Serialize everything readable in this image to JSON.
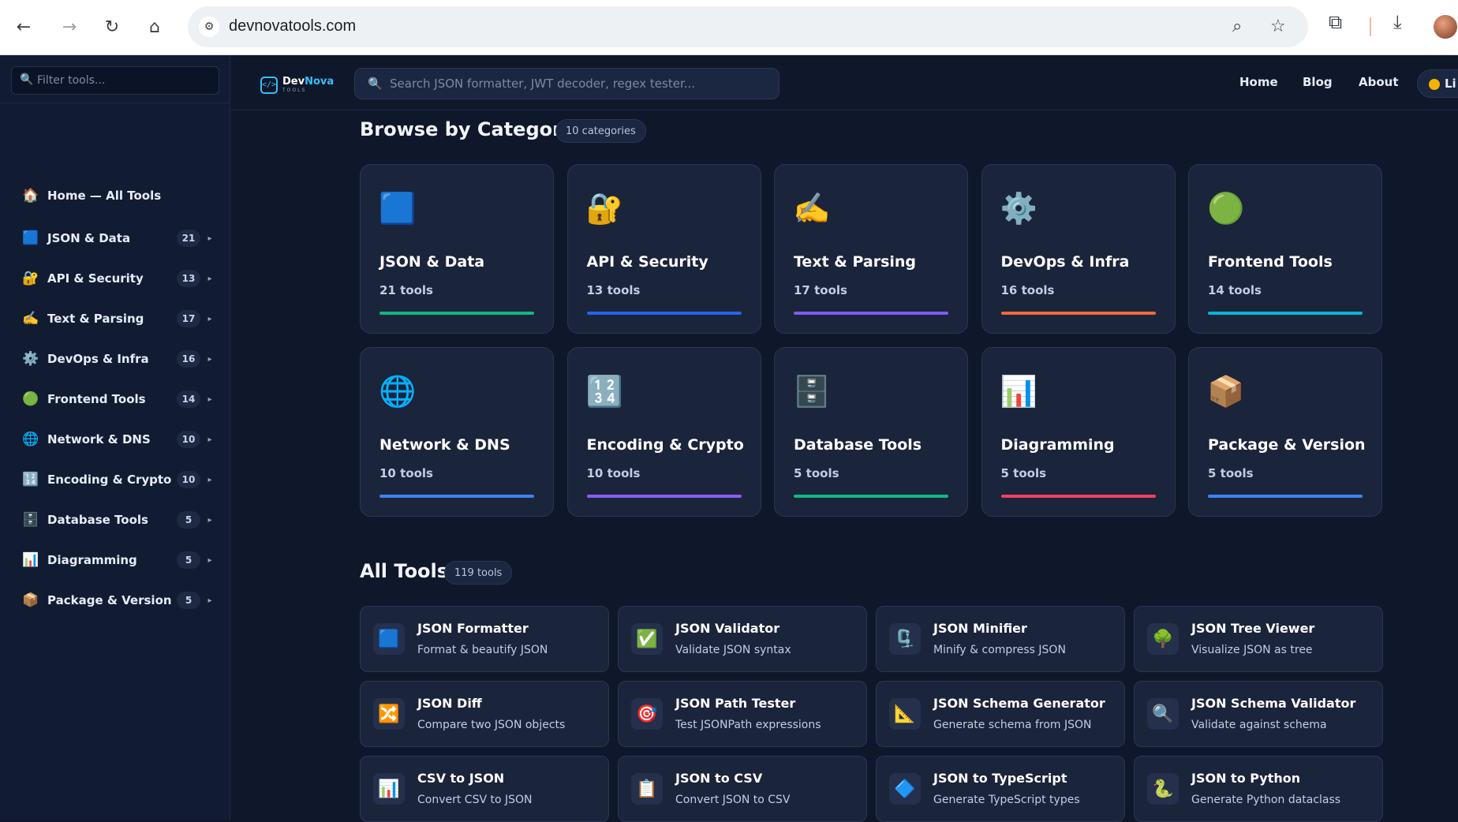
{
  "browser": {
    "url": "devnovatools.com",
    "icons": {
      "back": "back-arrow-icon",
      "forward": "forward-arrow-icon",
      "reload": "reload-icon",
      "home": "home-icon",
      "site_info": "site-info-icon",
      "zoom": "zoom-icon",
      "bookmark": "star-icon",
      "extensions": "puzzle-icon",
      "downloads": "download-icon"
    }
  },
  "app": {
    "logo": {
      "name_part1": "Dev",
      "name_part2": "Nova",
      "sub": "TOOLS",
      "mark": "</>"
    },
    "search": {
      "placeholder": "Search JSON formatter, JWT decoder, regex tester..."
    },
    "nav": {
      "home": "Home",
      "blog": "Blog",
      "about": "About",
      "theme": "Li"
    }
  },
  "sidebar": {
    "filter_placeholder": "Filter tools...",
    "home": {
      "icon": "🏠",
      "label": "Home — All Tools"
    },
    "items": [
      {
        "icon": "🟦",
        "label": "JSON & Data",
        "count": "21"
      },
      {
        "icon": "🔐",
        "label": "API & Security",
        "count": "13"
      },
      {
        "icon": "✍️",
        "label": "Text & Parsing",
        "count": "17"
      },
      {
        "icon": "⚙️",
        "label": "DevOps & Infra",
        "count": "16"
      },
      {
        "icon": "🟢",
        "label": "Frontend Tools",
        "count": "14"
      },
      {
        "icon": "🌐",
        "label": "Network & DNS",
        "count": "10"
      },
      {
        "icon": "🔢",
        "label": "Encoding & Crypto",
        "count": "10"
      },
      {
        "icon": "🗄️",
        "label": "Database Tools",
        "count": "5"
      },
      {
        "icon": "📊",
        "label": "Diagramming",
        "count": "5"
      },
      {
        "icon": "📦",
        "label": "Package & Version",
        "count": "5"
      }
    ],
    "arrow": "▸"
  },
  "categories": {
    "title": "Browse by Category",
    "count_label": "10 categories",
    "items": [
      {
        "icon": "🟦",
        "title": "JSON & Data",
        "count": "21 tools",
        "accent": "#10b981"
      },
      {
        "icon": "🔐",
        "title": "API & Security",
        "count": "13 tools",
        "accent": "#2563eb"
      },
      {
        "icon": "✍️",
        "title": "Text & Parsing",
        "count": "17 tools",
        "accent": "#7c5cf0"
      },
      {
        "icon": "⚙️",
        "title": "DevOps & Infra",
        "count": "16 tools",
        "accent": "#ef6a3a"
      },
      {
        "icon": "🟢",
        "title": "Frontend Tools",
        "count": "14 tools",
        "accent": "#06b6d4"
      },
      {
        "icon": "🌐",
        "title": "Network & DNS",
        "count": "10 tools",
        "accent": "#3b82f6"
      },
      {
        "icon": "🔢",
        "title": "Encoding & Crypto",
        "count": "10 tools",
        "accent": "#8b5cf6"
      },
      {
        "icon": "🗄️",
        "title": "Database Tools",
        "count": "5 tools",
        "accent": "#10b981"
      },
      {
        "icon": "📊",
        "title": "Diagramming",
        "count": "5 tools",
        "accent": "#f43f5e"
      },
      {
        "icon": "📦",
        "title": "Package & Version",
        "count": "5 tools",
        "accent": "#3b82f6"
      }
    ]
  },
  "all_tools": {
    "title": "All Tools",
    "count_label": "119 tools",
    "items": [
      {
        "icon": "🟦",
        "title": "JSON Formatter",
        "desc": "Format & beautify JSON"
      },
      {
        "icon": "✅",
        "title": "JSON Validator",
        "desc": "Validate JSON syntax"
      },
      {
        "icon": "🗜️",
        "title": "JSON Minifier",
        "desc": "Minify & compress JSON"
      },
      {
        "icon": "🌳",
        "title": "JSON Tree Viewer",
        "desc": "Visualize JSON as tree"
      },
      {
        "icon": "🔀",
        "title": "JSON Diff",
        "desc": "Compare two JSON objects"
      },
      {
        "icon": "🎯",
        "title": "JSON Path Tester",
        "desc": "Test JSONPath expressions"
      },
      {
        "icon": "📐",
        "title": "JSON Schema Generator",
        "desc": "Generate schema from JSON"
      },
      {
        "icon": "🔍",
        "title": "JSON Schema Validator",
        "desc": "Validate against schema"
      },
      {
        "icon": "📊",
        "title": "CSV to JSON",
        "desc": "Convert CSV to JSON"
      },
      {
        "icon": "📋",
        "title": "JSON to CSV",
        "desc": "Convert JSON to CSV"
      },
      {
        "icon": "🔷",
        "title": "JSON to TypeScript",
        "desc": "Generate TypeScript types"
      },
      {
        "icon": "🐍",
        "title": "JSON to Python",
        "desc": "Generate Python dataclass"
      }
    ]
  }
}
